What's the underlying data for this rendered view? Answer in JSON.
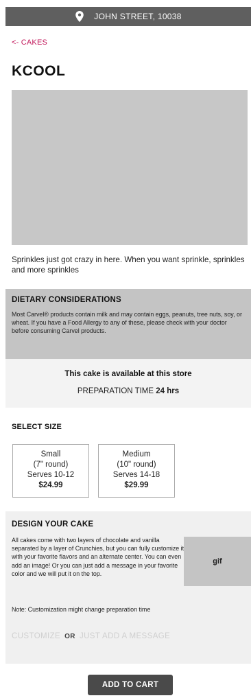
{
  "location": {
    "icon": "map-pin-icon",
    "address": "JOHN STREET, 10038"
  },
  "nav": {
    "back_label": "<- CAKES"
  },
  "product": {
    "title": "KCOOL",
    "description": "Sprinkles just got crazy in here. When you want sprinkle, sprinkles and more sprinkles"
  },
  "dietary": {
    "heading": "DIETARY CONSIDERATIONS",
    "text": "Most Carvel® products contain milk and may contain eggs, peanuts, tree nuts, soy, or wheat. If you have a Food Allergy to any of these, please check with your doctor before consuming Carvel products."
  },
  "availability": {
    "status": "This cake is available at this store",
    "prep_label": "PREPARATION TIME",
    "prep_value": "24 hrs"
  },
  "sizes": {
    "heading": "SELECT SIZE",
    "options": [
      {
        "name": "Small",
        "dimension": "(7\" round)",
        "serves": "Serves 10-12",
        "price": "$24.99"
      },
      {
        "name": "Medium",
        "dimension": "(10\" round)",
        "serves": "Serves 14-18",
        "price": "$29.99"
      }
    ]
  },
  "design": {
    "heading": "DESIGN YOUR CAKE",
    "text": "All cakes come with two layers of chocolate and vanilla separated by a layer of Crunchies, but you can fully customize it with your favorite flavors and an alternate center. You can even add an image! Or you can just add a message in your favorite color and we will put it on the top.",
    "gif_label": "gif",
    "note": "Note: Customization might change preparation time",
    "customize_label": "CUSTOMIZE",
    "or_label": "OR",
    "message_label": "JUST ADD A MESSAGE"
  },
  "cart": {
    "add_label": "ADD TO CART"
  },
  "colors": {
    "location_bar": "#5f5f5f",
    "back_link": "#c2185b",
    "image_placeholder": "#c7c7c7",
    "disabled_text": "#cfcfcf",
    "cart_button": "#4a4a4a"
  }
}
